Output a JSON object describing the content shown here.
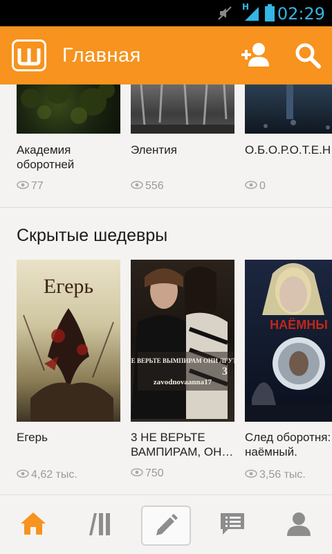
{
  "status_bar": {
    "time": "02:29",
    "icons": [
      "mute-icon",
      "signal-icon",
      "battery-icon"
    ],
    "network_label": "H"
  },
  "app_bar": {
    "title": "Главная",
    "logo": "wattpad-logo",
    "actions": [
      "add-friend-icon",
      "search-icon"
    ],
    "color": "#f7931e"
  },
  "sections": [
    {
      "title": "",
      "books": [
        {
          "title": "Академия оборотней",
          "views": "77"
        },
        {
          "title": "Элентия",
          "views": "556"
        },
        {
          "title": "О.Б.О.Р.О.Т.Е.Н",
          "views": "0"
        }
      ]
    },
    {
      "title": "Скрытые шедевры",
      "books": [
        {
          "title": "Егерь",
          "views": "4,62 тыс.",
          "cover_text": "Егерь"
        },
        {
          "title": "3 НЕ ВЕРЬТЕ ВАМПИРАМ, ОН…",
          "views": "750",
          "cover_text": "НЕ ВЕРЬТЕ ВЫМПИРАМ ОНИ ЛГУТ!",
          "cover_number": "3",
          "cover_author": "zavodnovaanna17"
        },
        {
          "title": "След оборотня: наёмный.",
          "views": "3,56 тыс.",
          "cover_text": "НАЁМНЫ"
        }
      ]
    }
  ],
  "bottom_nav": [
    "home-icon",
    "library-icon",
    "write-icon",
    "messages-icon",
    "profile-icon"
  ]
}
